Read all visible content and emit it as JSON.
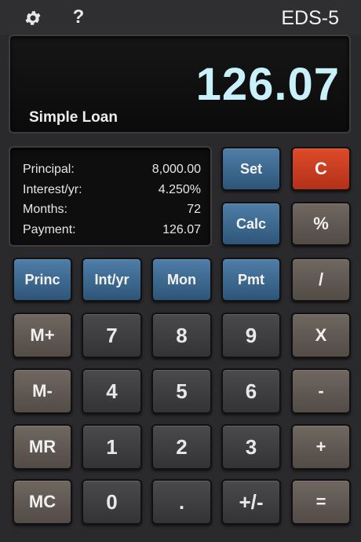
{
  "topbar": {
    "gear_icon": "gear-icon",
    "help_label": "?",
    "title": "EDS-5"
  },
  "display": {
    "value": "126.07",
    "mode": "Simple Loan"
  },
  "info": {
    "rows": [
      {
        "label": "Principal:",
        "value": "8,000.00"
      },
      {
        "label": "Interest/yr:",
        "value": "4.250%"
      },
      {
        "label": "Months:",
        "value": "72"
      },
      {
        "label": "Payment:",
        "value": "126.07"
      }
    ]
  },
  "keys": {
    "set": "Set",
    "clear": "C",
    "calc": "Calc",
    "percent": "%",
    "princ": "Princ",
    "int_yr": "Int/yr",
    "mon": "Mon",
    "pmt": "Pmt",
    "divide": "/",
    "m_plus": "M+",
    "seven": "7",
    "eight": "8",
    "nine": "9",
    "multiply": "X",
    "m_minus": "M-",
    "four": "4",
    "five": "5",
    "six": "6",
    "minus": "-",
    "mr": "MR",
    "one": "1",
    "two": "2",
    "three": "3",
    "plus": "+",
    "mc": "MC",
    "zero": "0",
    "dot": ".",
    "plus_minus": "+/-",
    "equals": "="
  },
  "colors": {
    "blue_key": "#3d6a92",
    "red_key": "#c93b20",
    "taupe_key": "#5f5852",
    "dark_key": "#3e3e40",
    "display_text": "#c8f1fb"
  }
}
